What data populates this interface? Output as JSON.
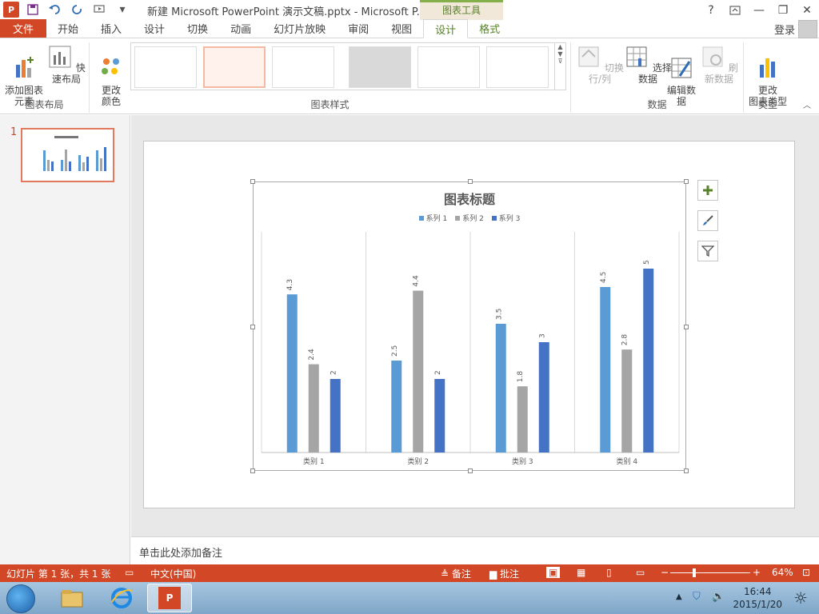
{
  "titlebar": {
    "app_icon_text": "P",
    "title": "新建 Microsoft PowerPoint 演示文稿.pptx - Microsoft P...",
    "context_tools": "图表工具",
    "help": "?",
    "minimize": "—",
    "restore": "❐",
    "close": "✕"
  },
  "tabs": {
    "file": "文件",
    "items": [
      "开始",
      "插入",
      "设计",
      "切换",
      "动画",
      "幻灯片放映",
      "审阅",
      "视图"
    ],
    "context_items": [
      "设计",
      "格式"
    ],
    "login": "登录"
  },
  "ribbon": {
    "add_element": "添加图表\n元素",
    "quick_layout": "快速布局",
    "group_layout": "图表布局",
    "change_color": "更改\n颜色",
    "group_styles": "图表样式",
    "switch_row_col": "切换行/列",
    "select_data": "选择数据",
    "edit_data": "编辑数\n据",
    "refresh_data": "刷新数据",
    "group_data": "数据",
    "change_type": "更改\n图表类型",
    "group_type": "类型"
  },
  "thumbpane": {
    "slide_number": "1"
  },
  "chart_data": {
    "type": "bar",
    "title": "图表标题",
    "categories": [
      "类别 1",
      "类别 2",
      "类别 3",
      "类别 4"
    ],
    "series": [
      {
        "name": "系列 1",
        "values": [
          4.3,
          2.5,
          3.5,
          4.5
        ],
        "color": "#5b9bd5"
      },
      {
        "name": "系列 2",
        "values": [
          2.4,
          4.4,
          1.8,
          2.8
        ],
        "color": "#a5a5a5"
      },
      {
        "name": "系列 3",
        "values": [
          2,
          2,
          3,
          5
        ],
        "color": "#4472c4"
      }
    ],
    "ylim": [
      0,
      6
    ],
    "legend": "top",
    "data_labels": true
  },
  "notes": {
    "placeholder": "单击此处添加备注"
  },
  "statusbar": {
    "slide_info": "幻灯片 第 1 张，共 1 张",
    "language": "中文(中国)",
    "notes_btn": "备注",
    "comments_btn": "批注",
    "zoom": "64%"
  },
  "taskbar": {
    "time": "16:44",
    "date": "2015/1/20"
  }
}
